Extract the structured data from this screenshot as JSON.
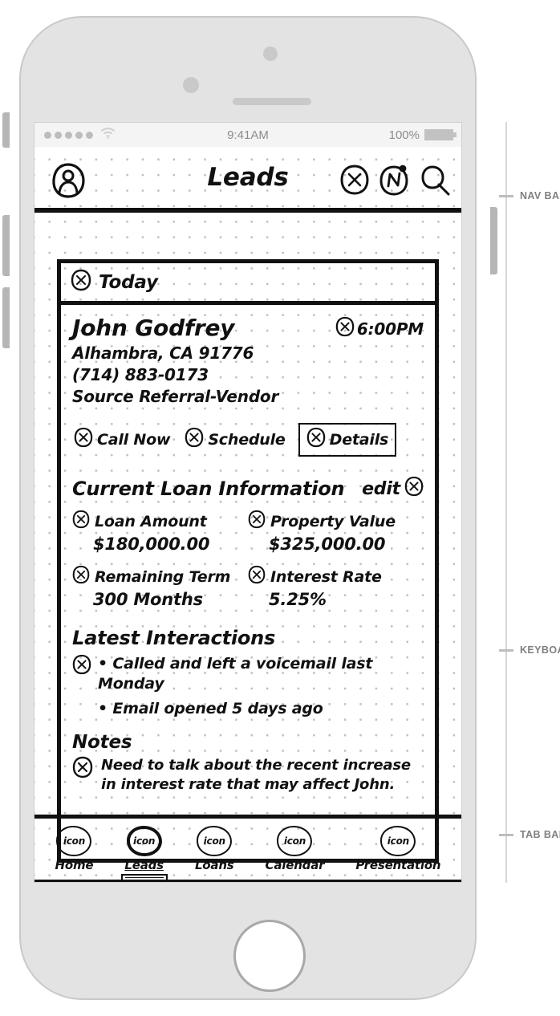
{
  "status_bar": {
    "signal_dots": 5,
    "wifi_icon": "wifi-icon",
    "time": "9:41AM",
    "battery_percent": "100%"
  },
  "nav_bar": {
    "annotation": "NAV BAR",
    "profile_icon": "profile-avatar-icon",
    "title": "Leads",
    "actions": [
      {
        "icon": "circled-x-add-icon",
        "name": "add"
      },
      {
        "icon": "circled-n-notification-icon",
        "name": "notifications"
      },
      {
        "icon": "magnifier-search-icon",
        "name": "search"
      }
    ]
  },
  "content": {
    "today_header": "Today",
    "lead": {
      "name": "John Godfrey",
      "city_state_zip": "Alhambra, CA 91776",
      "phone": "(714) 883-0173",
      "source": "Source Referral-Vendor",
      "appointment_time": "6:00PM"
    },
    "actions": [
      {
        "label": "Call Now",
        "selected": false
      },
      {
        "label": "Schedule",
        "selected": false
      },
      {
        "label": "Details",
        "selected": true
      }
    ],
    "loan_section": {
      "title": "Current Loan Information",
      "edit_label": "edit",
      "fields": [
        {
          "label": "Loan Amount",
          "value": "$180,000.00"
        },
        {
          "label": "Property Value",
          "value": "$325,000.00"
        },
        {
          "label": "Remaining Term",
          "value": "300 Months"
        },
        {
          "label": "Interest Rate",
          "value": "5.25%"
        }
      ]
    },
    "interactions_section": {
      "title": "Latest Interactions",
      "items": [
        "• Called and left a voicemail last Monday",
        "• Email opened 5 days ago"
      ]
    },
    "notes_section": {
      "title": "Notes",
      "text": "Need to talk about the recent increase in interest rate that may affect John."
    }
  },
  "tab_bar": {
    "annotation": "TAB BAR",
    "icon_label": "icon",
    "items": [
      {
        "label": "Home",
        "active": false
      },
      {
        "label": "Leads",
        "active": true
      },
      {
        "label": "Loans",
        "active": false
      },
      {
        "label": "Calendar",
        "active": false
      },
      {
        "label": "Presentation",
        "active": false
      }
    ]
  },
  "annotations": {
    "keyboard": "KEYBOARD"
  },
  "colors": {
    "ink": "#111111",
    "shell": "#e3e3e3",
    "dot_grid": "#bfbfbf",
    "status_text": "#8c8c8c",
    "annotation_text": "#808080"
  }
}
